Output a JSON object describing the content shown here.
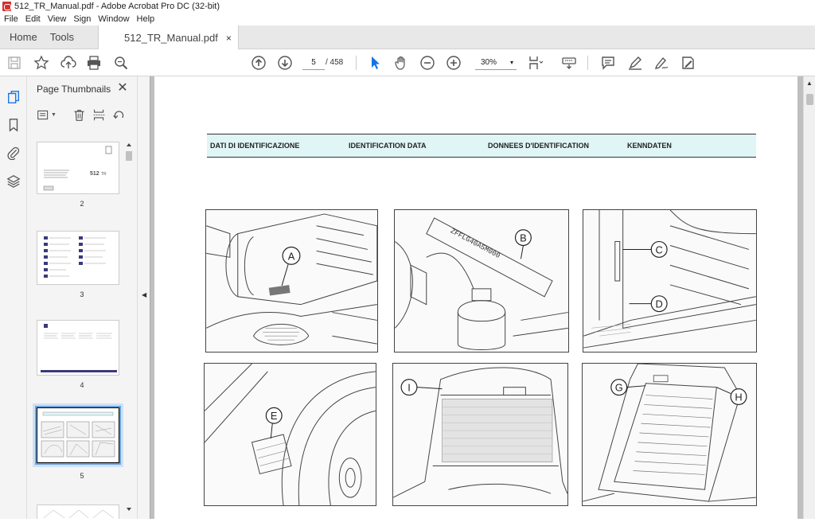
{
  "window": {
    "title": "512_TR_Manual.pdf - Adobe Acrobat Pro DC (32-bit)"
  },
  "menu": [
    "File",
    "Edit",
    "View",
    "Sign",
    "Window",
    "Help"
  ],
  "tabs": {
    "home": "Home",
    "tools": "Tools",
    "document": "512_TR_Manual.pdf",
    "close": "×"
  },
  "toolbar": {
    "current_page": "5",
    "page_count": "/ 458",
    "zoom": "30%",
    "zoom_caret": "▾"
  },
  "panel": {
    "title": "Page Thumbnails",
    "close": "✕",
    "thumbnails": [
      {
        "label": "2"
      },
      {
        "label": "3"
      },
      {
        "label": "4"
      },
      {
        "label": "5",
        "selected": true
      }
    ]
  },
  "document": {
    "header": {
      "it": "DATI DI IDENTIFICAZIONE",
      "en": "IDENTIFICATION DATA",
      "fr": "DONNEES D'IDENTIFICATION",
      "de": "KENNDATEN"
    },
    "callouts": [
      "A",
      "B",
      "C",
      "D",
      "E",
      "I",
      "G",
      "H"
    ],
    "stamped_plate_text": "ZFFLG40A5M000"
  },
  "colors": {
    "accent": "#1473e6",
    "header_band": "#dff5f6",
    "doc_background": "#bfbfbf"
  }
}
